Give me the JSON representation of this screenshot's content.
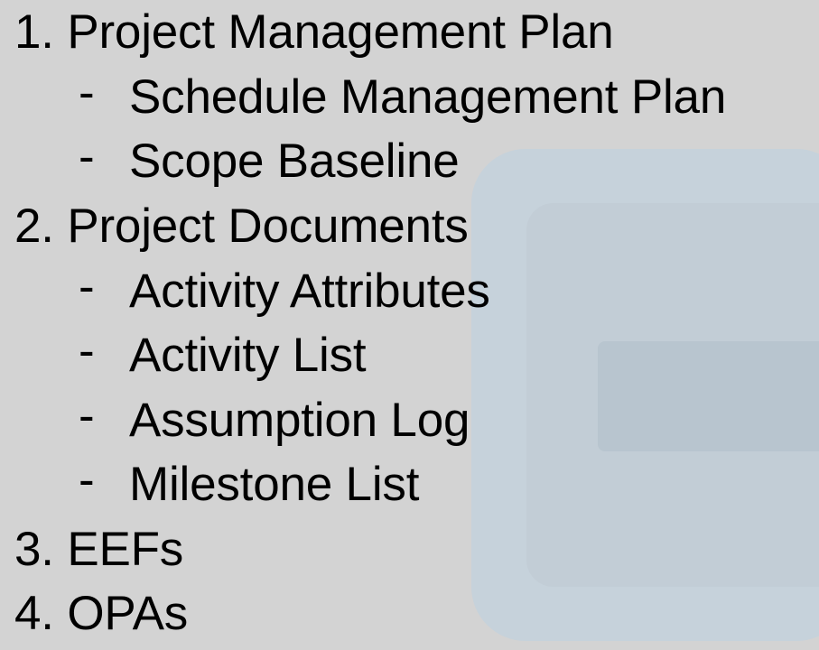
{
  "outline": [
    {
      "text": "1. Project Management Plan",
      "level": 1
    },
    {
      "bullet": "-",
      "text": "Schedule Management Plan",
      "level": 2
    },
    {
      "bullet": "-",
      "text": "Scope Baseline",
      "level": 2
    },
    {
      "text": "2. Project Documents",
      "level": 1
    },
    {
      "bullet": "-",
      "text": "Activity Attributes",
      "level": 2
    },
    {
      "bullet": "-",
      "text": "Activity List",
      "level": 2
    },
    {
      "bullet": "-",
      "text": "Assumption Log",
      "level": 2
    },
    {
      "bullet": "-",
      "text": "Milestone List",
      "level": 2
    },
    {
      "text": "3. EEFs",
      "level": 1
    },
    {
      "text": "4. OPAs",
      "level": 1
    }
  ],
  "colors": {
    "background": "#d3d3d3",
    "panel_outer": "#c6d2db",
    "panel_inner": "#c2cdd6",
    "panel_bar": "#b8c5cf",
    "text": "#000000"
  }
}
